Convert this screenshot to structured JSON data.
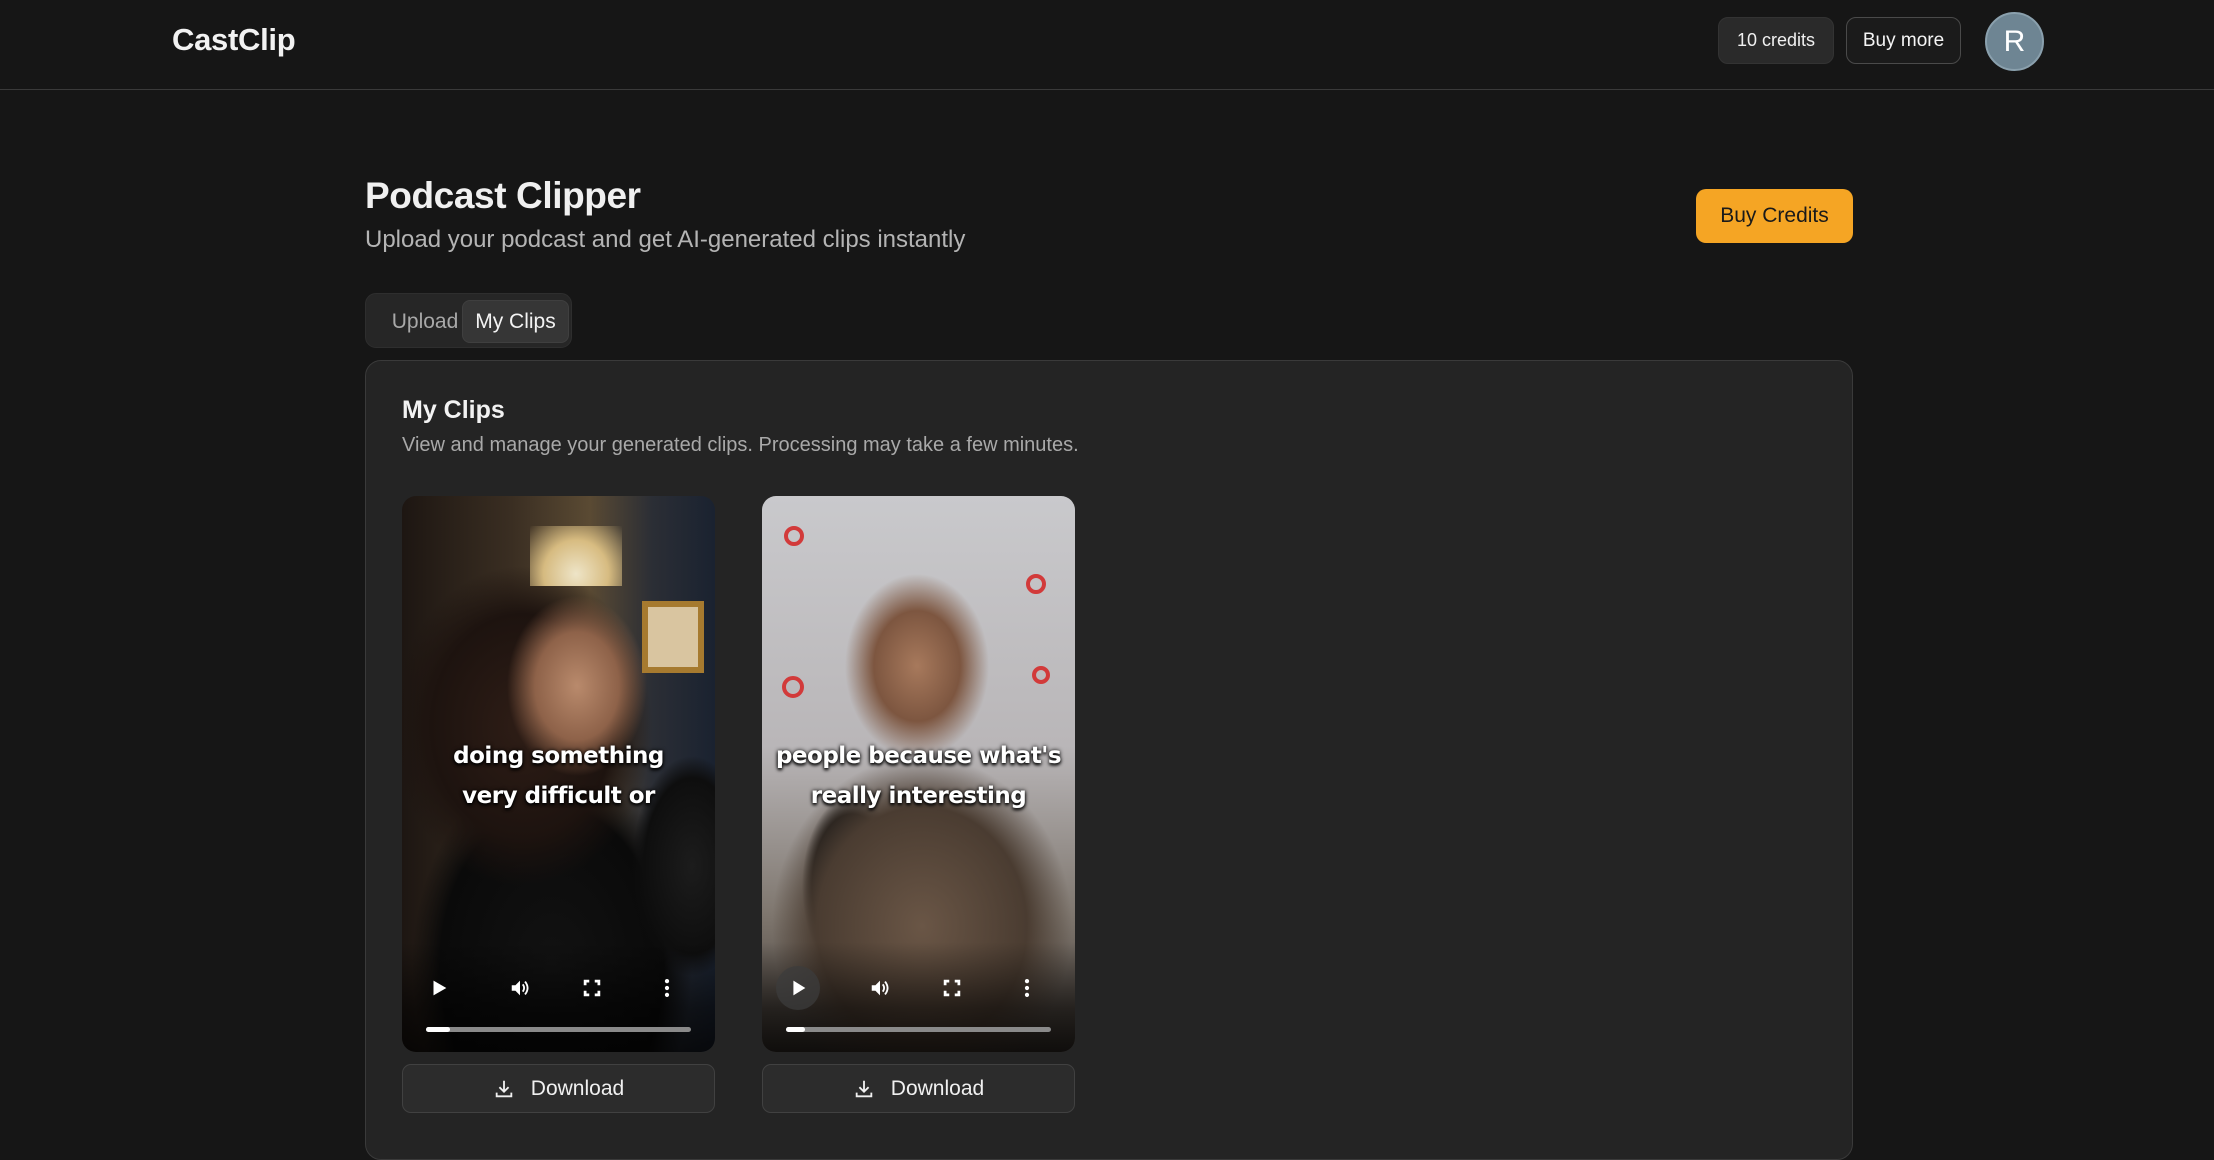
{
  "header": {
    "brand": "CastClip",
    "credits": "10 credits",
    "buy_more": "Buy more",
    "avatar_initial": "R"
  },
  "page": {
    "title": "Podcast Clipper",
    "subtitle": "Upload your podcast and get AI-generated clips instantly",
    "buy_credits": "Buy Credits",
    "accent_color": "#f5a524"
  },
  "tabs": [
    {
      "label": "Upload",
      "active": false
    },
    {
      "label": "My Clips",
      "active": true
    }
  ],
  "panel": {
    "title": "My Clips",
    "description": "View and manage your generated clips. Processing may take a few minutes."
  },
  "clips": [
    {
      "caption_line1": "doing something",
      "caption_line2": "very difficult or",
      "progress": 0.09,
      "download_label": "Download"
    },
    {
      "caption_line1": "people because what's",
      "caption_line2": "really interesting",
      "progress": 0.07,
      "download_label": "Download"
    }
  ],
  "icons": {
    "play": "play-icon",
    "volume": "volume-icon",
    "fullscreen": "fullscreen-icon",
    "more": "more-vertical-icon",
    "download": "download-icon"
  }
}
